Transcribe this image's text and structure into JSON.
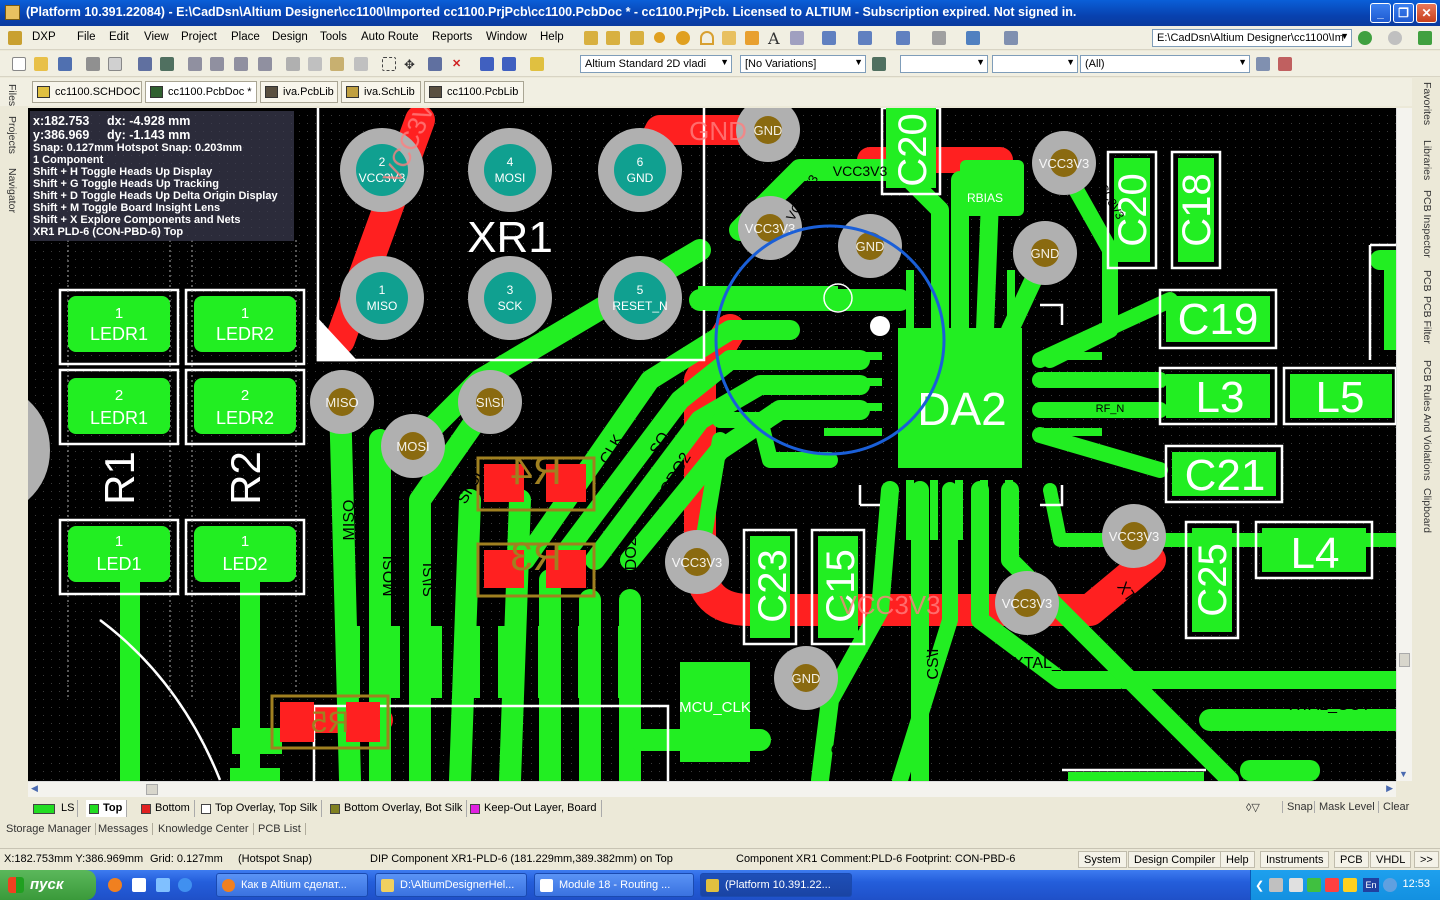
{
  "window": {
    "title": "(Platform 10.391.22084) - E:\\CadDsn\\Altium Designer\\cc1100\\Imported cc1100.PrjPcb\\cc1100.PcbDoc * - cc1100.PrjPcb. Licensed to ALTIUM - Subscription expired. Not signed in.",
    "minimize": "_",
    "maximize": "❐",
    "close": "✕"
  },
  "menubar": {
    "dxp": "DXP",
    "items": [
      "File",
      "Edit",
      "View",
      "Project",
      "Place",
      "Design",
      "Tools",
      "Auto Route",
      "Reports",
      "Window",
      "Help"
    ],
    "path_combo": "E:\\CadDsn\\Altium Designer\\cc1100\\Im"
  },
  "toolbar2": {
    "view_config": "Altium Standard 2D vladi",
    "variations": "[No Variations]",
    "filter_all": "(All)"
  },
  "doc_tabs": [
    {
      "label": "cc1100.SCHDOC",
      "active": false
    },
    {
      "label": "cc1100.PcbDoc *",
      "active": true
    },
    {
      "label": "iva.PcbLib",
      "active": false
    },
    {
      "label": "iva.SchLib",
      "active": false
    },
    {
      "label": "cc1100.PcbLib",
      "active": false
    }
  ],
  "left_panels": [
    "Files",
    "Projects",
    "Navigator"
  ],
  "right_panels": [
    "Favorites",
    "Libraries",
    "PCB Inspector",
    "PCB",
    "PCB Filter",
    "PCB Rules And Violations",
    "Clipboard"
  ],
  "hud": {
    "x": "x:182.753",
    "dx": "dx: -4.928  mm",
    "y": "y:386.969",
    "dy": "dy: -1.143  mm",
    "snap": "Snap: 0.127mm Hotspot Snap: 0.203mm",
    "count": "1 Component",
    "shortcuts": [
      "Shift + H   Toggle Heads Up Display",
      "Shift + G   Toggle Heads Up Tracking",
      "Shift + D   Toggle Heads Up Delta Origin Display",
      "Shift + M   Toggle Board Insight Lens",
      "Shift + X   Explore Components and Nets"
    ],
    "component": "XR1  PLD-6 (CON-PBD-6)  Top"
  },
  "pcb": {
    "designators": {
      "xr1": "XR1",
      "da2": "DA2",
      "r1": "R1",
      "r2": "R2",
      "c18": "C18",
      "c19": "C19",
      "c20": "C20",
      "c21": "C21",
      "c23": "C23",
      "c25": "C25",
      "c15": "C15",
      "l3": "L3",
      "l4": "L4",
      "l5": "L5",
      "r4": "R4",
      "r3": "R3",
      "r5": "R5",
      "rbias": "RBIAS"
    },
    "pad_labels": {
      "ledr1a": "LEDR1",
      "ledr1b": "LEDR1",
      "led1": "LED1",
      "ledr2a": "LEDR2",
      "ledr2b": "LEDR2",
      "led2": "LED2",
      "mcu_clk": "MCU_CLK"
    },
    "xr1_pads": [
      {
        "num": "2",
        "net": "VCC3V3"
      },
      {
        "num": "4",
        "net": "MOSI"
      },
      {
        "num": "6",
        "net": "GND"
      },
      {
        "num": "1",
        "net": "MISO"
      },
      {
        "num": "3",
        "net": "SCK"
      },
      {
        "num": "5",
        "net": "RESET_N"
      }
    ],
    "vias": [
      "GND",
      "VCC3V3",
      "GND",
      "GND",
      "VCC3V3",
      "MISO",
      "SI\\SI",
      "MOSI",
      "VCC3V3",
      "GND",
      "VCC3V3",
      "VCC3V3",
      "GND"
    ],
    "nets": {
      "gnd": "GND",
      "vcc": "VCC3V3",
      "miso": "MISO",
      "mosi": "MOSI",
      "sisi": "SI\\SI",
      "si": "SI",
      "clk": "CLK",
      "so": "SO",
      "gdo2": "GDO2",
      "gdo0": "GDO0",
      "csi": "CS\\I",
      "xtal_in": "XTAL_IN",
      "xtal_out": "XTAL_OUT",
      "rf_n": "RF_N"
    },
    "pin_numbers": [
      "1",
      "2",
      "1",
      "2",
      "1",
      "1"
    ]
  },
  "layer_tabs": [
    {
      "label": "LS",
      "color": "#22dd22"
    },
    {
      "label": "Top",
      "color": "#22dd22"
    },
    {
      "label": "Bottom",
      "color": "#e02020"
    },
    {
      "label": "Top Overlay, Top Silk",
      "color": "#ffffff"
    },
    {
      "label": "Bottom Overlay, Bot Silk",
      "color": "#808020"
    },
    {
      "label": "Keep-Out Layer, Board",
      "color": "#e020e0"
    }
  ],
  "layer_right": {
    "snap": "Snap",
    "mask": "Mask Level",
    "clear": "Clear"
  },
  "panel_tabs": [
    "Storage Manager",
    "Messages",
    "Knowledge Center",
    "PCB List"
  ],
  "status": {
    "coords": "X:182.753mm Y:386.969mm",
    "grid": "Grid: 0.127mm",
    "snap": "(Hotspot Snap)",
    "component_info": "DIP Component XR1-PLD-6 (181.229mm,389.382mm) on Top",
    "comment": "Component XR1 Comment:PLD-6 Footprint: CON-PBD-6",
    "buttons": [
      "System",
      "Design Compiler",
      "Help",
      "Instruments",
      "PCB",
      "VHDL",
      ">>"
    ]
  },
  "taskbar": {
    "start": "пуск",
    "tasks": [
      {
        "label": "Как в Altium сделат...",
        "active": false
      },
      {
        "label": "D:\\AltiumDesignerHel...",
        "active": false
      },
      {
        "label": "Module 18 - Routing ...",
        "active": false
      },
      {
        "label": "(Platform 10.391.22...",
        "active": true
      }
    ],
    "lang": "En",
    "clock": "12:53"
  }
}
